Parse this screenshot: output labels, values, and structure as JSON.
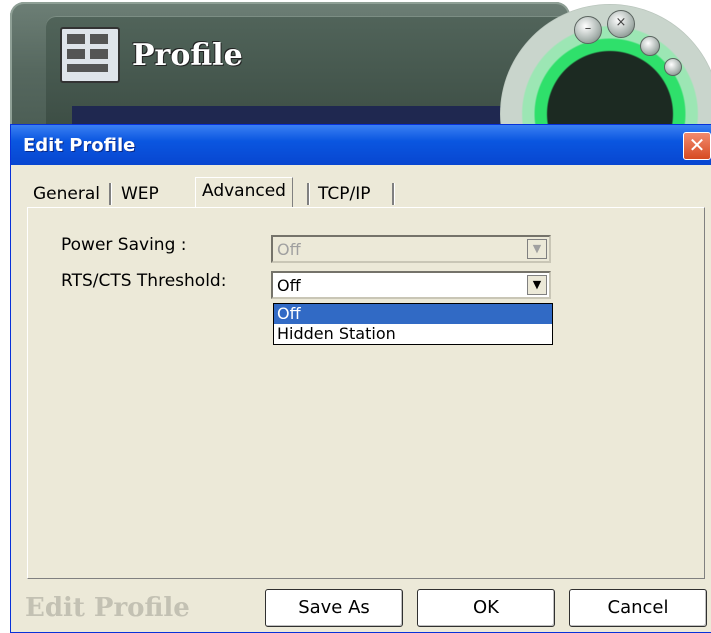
{
  "app": {
    "title": "Profile"
  },
  "dialog": {
    "title": "Edit Profile",
    "close_label": "✕",
    "tabs": [
      {
        "label": "General"
      },
      {
        "label": "WEP"
      },
      {
        "label": "Advanced",
        "selected": true
      },
      {
        "label": "TCP/IP"
      }
    ],
    "fields": {
      "power_saving": {
        "label": "Power Saving :",
        "value": "Off",
        "disabled": true
      },
      "rts_cts": {
        "label": "RTS/CTS Threshold:",
        "value": "Off"
      }
    },
    "dropdown_options": [
      {
        "label": "Off",
        "selected": true
      },
      {
        "label": "Hidden Station"
      }
    ],
    "footer_title": "Edit Profile",
    "buttons": {
      "save_as": "Save As",
      "ok": "OK",
      "cancel": "Cancel"
    }
  },
  "colors": {
    "titlebar": "#0a56e0",
    "selection": "#316ac5",
    "dialog_bg": "#ece9d8"
  }
}
